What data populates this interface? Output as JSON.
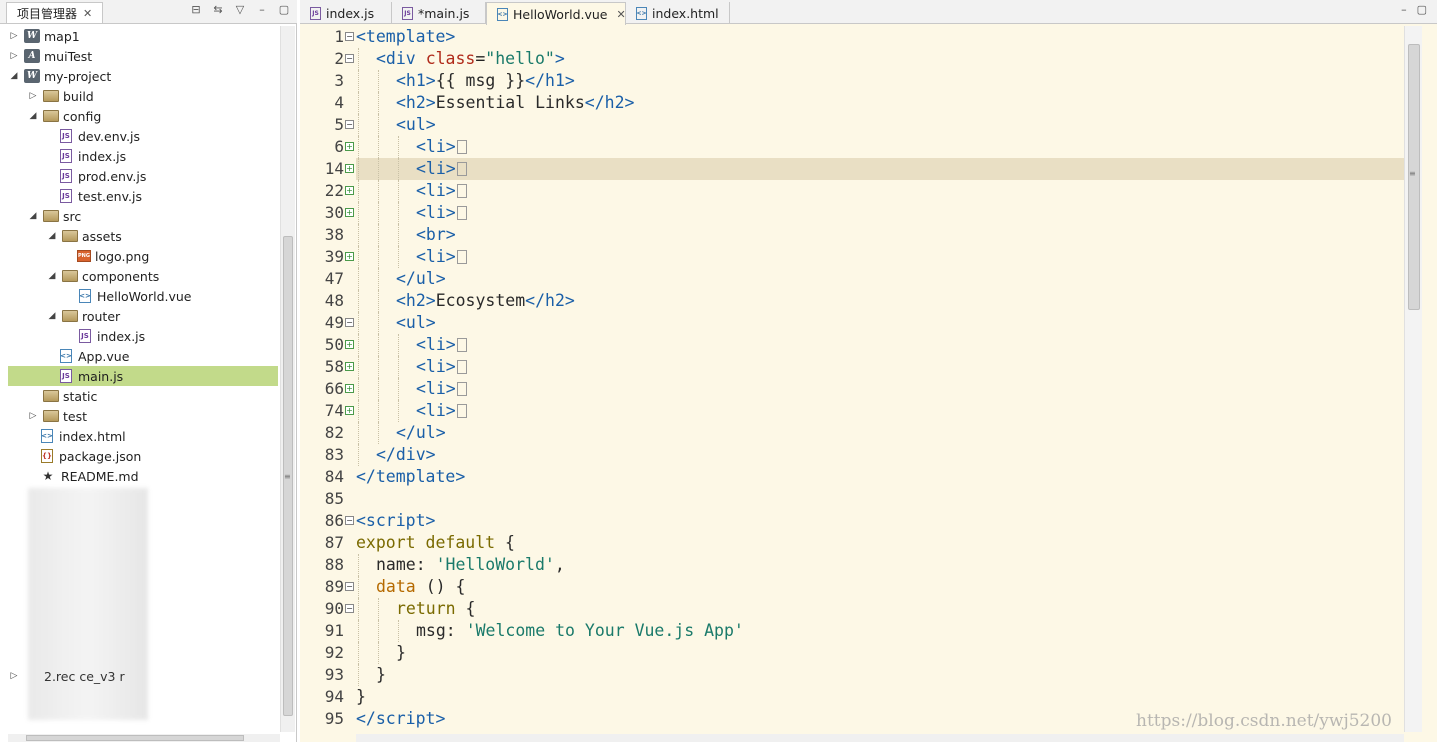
{
  "project_panel": {
    "tab_label": "项目管理器",
    "tree": [
      {
        "label": "map1",
        "depth": 0,
        "kind": "project",
        "expanded": false
      },
      {
        "label": "muiTest",
        "depth": 0,
        "kind": "project-a",
        "expanded": false
      },
      {
        "label": "my-project",
        "depth": 0,
        "kind": "project",
        "expanded": true
      },
      {
        "label": "build",
        "depth": 1,
        "kind": "folder",
        "expanded": false
      },
      {
        "label": "config",
        "depth": 1,
        "kind": "folder",
        "expanded": true
      },
      {
        "label": "dev.env.js",
        "depth": 2,
        "kind": "js"
      },
      {
        "label": "index.js",
        "depth": 2,
        "kind": "js"
      },
      {
        "label": "prod.env.js",
        "depth": 2,
        "kind": "js"
      },
      {
        "label": "test.env.js",
        "depth": 2,
        "kind": "js"
      },
      {
        "label": "src",
        "depth": 1,
        "kind": "folder",
        "expanded": true
      },
      {
        "label": "assets",
        "depth": 2,
        "kind": "folder",
        "expanded": true
      },
      {
        "label": "logo.png",
        "depth": 3,
        "kind": "png"
      },
      {
        "label": "components",
        "depth": 2,
        "kind": "folder",
        "expanded": true
      },
      {
        "label": "HelloWorld.vue",
        "depth": 3,
        "kind": "vue"
      },
      {
        "label": "router",
        "depth": 2,
        "kind": "folder",
        "expanded": true
      },
      {
        "label": "index.js",
        "depth": 3,
        "kind": "js"
      },
      {
        "label": "App.vue",
        "depth": 2,
        "kind": "vue"
      },
      {
        "label": "main.js",
        "depth": 2,
        "kind": "js",
        "selected": true
      },
      {
        "label": "static",
        "depth": 1,
        "kind": "folder"
      },
      {
        "label": "test",
        "depth": 1,
        "kind": "folder",
        "expanded": false
      },
      {
        "label": "index.html",
        "depth": 1,
        "kind": "vue"
      },
      {
        "label": "package.json",
        "depth": 1,
        "kind": "json"
      },
      {
        "label": "README.md",
        "depth": 1,
        "kind": "md"
      }
    ],
    "partial_label": "2.rec         ce_v3          r"
  },
  "editor": {
    "tabs": [
      {
        "label": "index.js",
        "icon": "js"
      },
      {
        "label": "*main.js",
        "icon": "js"
      },
      {
        "label": "HelloWorld.vue",
        "icon": "vue",
        "active": true
      },
      {
        "label": "index.html",
        "icon": "vue"
      }
    ],
    "lines": [
      {
        "n": "1",
        "fold": "minus",
        "indent": 0,
        "html": "<span class='c-tag'>&lt;template&gt;</span>"
      },
      {
        "n": "2",
        "fold": "minus",
        "indent": 1,
        "html": "<span class='c-tag'>&lt;div</span> <span class='c-attr'>class</span>=<span class='c-str'>\"hello\"</span><span class='c-tag'>&gt;</span>"
      },
      {
        "n": "3",
        "fold": "",
        "indent": 2,
        "html": "<span class='c-tag'>&lt;h1&gt;</span><span class='c-txt'>{{ msg }}</span><span class='c-tag'>&lt;/h1&gt;</span>"
      },
      {
        "n": "4",
        "fold": "",
        "indent": 2,
        "html": "<span class='c-tag'>&lt;h2&gt;</span><span class='c-txt'>Essential Links</span><span class='c-tag'>&lt;/h2&gt;</span>"
      },
      {
        "n": "5",
        "fold": "minus",
        "indent": 2,
        "html": "<span class='c-tag'>&lt;ul&gt;</span>"
      },
      {
        "n": "6",
        "fold": "plus",
        "indent": 3,
        "html": "<span class='c-tag'>&lt;li&gt;</span><span class='collapsed'></span>"
      },
      {
        "n": "14",
        "fold": "plus",
        "indent": 3,
        "html": "<span class='c-tag'>&lt;li&gt;</span><span class='collapsed'></span>",
        "highlight": true
      },
      {
        "n": "22",
        "fold": "plus",
        "indent": 3,
        "html": "<span class='c-tag'>&lt;li&gt;</span><span class='collapsed'></span>"
      },
      {
        "n": "30",
        "fold": "plus",
        "indent": 3,
        "html": "<span class='c-tag'>&lt;li&gt;</span><span class='collapsed'></span>"
      },
      {
        "n": "38",
        "fold": "",
        "indent": 3,
        "html": "<span class='c-tag'>&lt;br&gt;</span>"
      },
      {
        "n": "39",
        "fold": "plus",
        "indent": 3,
        "html": "<span class='c-tag'>&lt;li&gt;</span><span class='collapsed'></span>"
      },
      {
        "n": "47",
        "fold": "",
        "indent": 2,
        "html": "<span class='c-tag'>&lt;/ul&gt;</span>"
      },
      {
        "n": "48",
        "fold": "",
        "indent": 2,
        "html": "<span class='c-tag'>&lt;h2&gt;</span><span class='c-txt'>Ecosystem</span><span class='c-tag'>&lt;/h2&gt;</span>"
      },
      {
        "n": "49",
        "fold": "minus",
        "indent": 2,
        "html": "<span class='c-tag'>&lt;ul&gt;</span>"
      },
      {
        "n": "50",
        "fold": "plus",
        "indent": 3,
        "html": "<span class='c-tag'>&lt;li&gt;</span><span class='collapsed'></span>"
      },
      {
        "n": "58",
        "fold": "plus",
        "indent": 3,
        "html": "<span class='c-tag'>&lt;li&gt;</span><span class='collapsed'></span>"
      },
      {
        "n": "66",
        "fold": "plus",
        "indent": 3,
        "html": "<span class='c-tag'>&lt;li&gt;</span><span class='collapsed'></span>"
      },
      {
        "n": "74",
        "fold": "plus",
        "indent": 3,
        "html": "<span class='c-tag'>&lt;li&gt;</span><span class='collapsed'></span>"
      },
      {
        "n": "82",
        "fold": "",
        "indent": 2,
        "html": "<span class='c-tag'>&lt;/ul&gt;</span>"
      },
      {
        "n": "83",
        "fold": "",
        "indent": 1,
        "html": "<span class='c-tag'>&lt;/div&gt;</span>"
      },
      {
        "n": "84",
        "fold": "",
        "indent": 0,
        "html": "<span class='c-tag'>&lt;/template&gt;</span>"
      },
      {
        "n": "85",
        "fold": "",
        "indent": 0,
        "html": ""
      },
      {
        "n": "86",
        "fold": "minus",
        "indent": 0,
        "html": "<span class='c-tag'>&lt;script&gt;</span>"
      },
      {
        "n": "87",
        "fold": "",
        "indent": 0,
        "html": "<span class='c-kw'>export default</span> <span class='c-plain'>{</span>"
      },
      {
        "n": "88",
        "fold": "",
        "indent": 1,
        "html": "<span class='c-key'>name:</span> <span class='c-str'>'HelloWorld'</span><span class='c-plain'>,</span>"
      },
      {
        "n": "89",
        "fold": "minus",
        "indent": 1,
        "html": "<span class='c-fn'>data</span> <span class='c-plain'>() {</span>"
      },
      {
        "n": "90",
        "fold": "minus",
        "indent": 2,
        "html": "<span class='c-kw'>return</span> <span class='c-plain'>{</span>"
      },
      {
        "n": "91",
        "fold": "",
        "indent": 3,
        "html": "<span class='c-key'>msg:</span> <span class='c-str'>'Welcome to Your Vue.js App'</span>"
      },
      {
        "n": "92",
        "fold": "",
        "indent": 2,
        "html": "<span class='c-plain'>}</span>"
      },
      {
        "n": "93",
        "fold": "",
        "indent": 1,
        "html": "<span class='c-plain'>}</span>"
      },
      {
        "n": "94",
        "fold": "",
        "indent": 0,
        "html": "<span class='c-plain'>}</span>"
      },
      {
        "n": "95",
        "fold": "",
        "indent": 0,
        "html": "<span class='c-tag'>&lt;/script&gt;</span>"
      }
    ]
  },
  "watermark": "https://blog.csdn.net/ywj5200",
  "colors": {
    "editor_bg": "#fdf8e6",
    "current_line": "#e9dfc4",
    "selection": "#c2da8a",
    "tag": "#1a5fa8",
    "attr": "#b02a1a",
    "string": "#1a7a6a",
    "keyword": "#7a6a00"
  }
}
